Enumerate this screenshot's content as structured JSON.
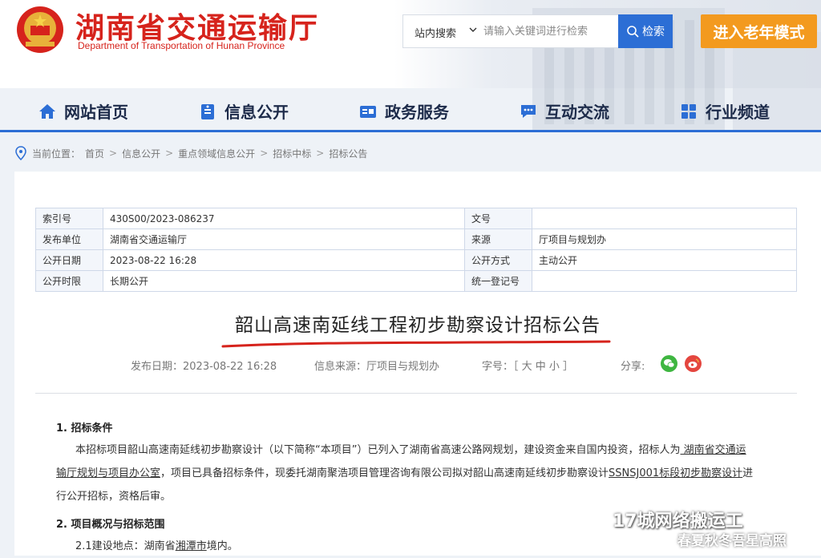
{
  "header": {
    "title": "湖南省交通运输厅",
    "subtitle": "Department of Transportation of Hunan Province",
    "search_scope": "站内搜索",
    "search_placeholder": "请输入关键词进行检索",
    "search_button": "检索",
    "elder_mode": "进入老年模式"
  },
  "nav": {
    "items": [
      {
        "label": "网站首页",
        "icon": "home-icon"
      },
      {
        "label": "信息公开",
        "icon": "doc-icon"
      },
      {
        "label": "政务服务",
        "icon": "card-icon"
      },
      {
        "label": "互动交流",
        "icon": "chat-icon"
      },
      {
        "label": "行业频道",
        "icon": "grid-icon"
      }
    ]
  },
  "breadcrumb": {
    "prefix": "当前位置：",
    "items": [
      "首页",
      "信息公开",
      "重点领域信息公开",
      "招标中标",
      "招标公告"
    ],
    "sep": ">"
  },
  "meta": {
    "rows": [
      {
        "k1": "索引号",
        "v1": "430S00/2023-086237",
        "k2": "文号",
        "v2": ""
      },
      {
        "k1": "发布单位",
        "v1": "湖南省交通运输厅",
        "k2": "来源",
        "v2": "厅项目与规划办"
      },
      {
        "k1": "公开日期",
        "v1": "2023-08-22 16:28",
        "k2": "公开方式",
        "v2": "主动公开"
      },
      {
        "k1": "公开时限",
        "v1": "长期公开",
        "k2": "统一登记号",
        "v2": ""
      }
    ]
  },
  "article": {
    "title": "韶山高速南延线工程初步勘察设计招标公告",
    "publish_date": "发布日期：2023-08-22 16:28",
    "source": "信息来源：厅项目与规划办",
    "font_size": "字号：［ 大 中 小 ］",
    "share": "分享:",
    "section1": "1. 招标条件",
    "para1_a": "本招标项目韶山高速南延线初步勘察设计（以下简称“本项目”）已列入了湖南省高速公路网规划，建设资金来自国内投资，招标人为",
    "para1_link": " 湖南省交通运",
    "para1_b_link": "输厅规划与项目办公室",
    "para1_b": "，项目已具备招标条件，现委托湖南聚浩项目管理咨询有限公司拟对韶山高速南延线初步勘察设计",
    "para1_b_code": "SSNSJ001标段初步勘察设计",
    "para1_b_end": "进",
    "para1_c": "行公开招标，资格后审。",
    "section2": "2. 项目概况与招标范围",
    "para2_a": "2.1建设地点：湖南省",
    "para2_link": "湘潭市",
    "para2_b": "境内。"
  },
  "watermark": {
    "line1": "17城网络搬运工",
    "line2": "春夏秋冬吾星高照"
  },
  "colors": {
    "brand_red": "#d6231c",
    "accent_blue": "#2c6ed5",
    "elder_orange": "#f39a1f"
  }
}
